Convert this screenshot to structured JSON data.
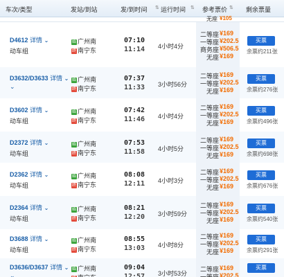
{
  "columns": {
    "train": "车次/类型",
    "stations": "发站/到站",
    "times": "发/到时间",
    "duration": "运行时间",
    "price": "参考票价",
    "remain": "剩余票量"
  },
  "top_strip": {
    "seat": "无座",
    "price": "¥105"
  },
  "rows": [
    {
      "train_no": "D4612",
      "detail": "详情",
      "type": "动车组",
      "from": "广州南",
      "to": "南宁东",
      "dep": "07:10",
      "arr": "11:14",
      "duration": "4小时4分",
      "seats": [
        {
          "n": "二等座",
          "p": "¥169"
        },
        {
          "n": "一等座",
          "p": "¥202.5"
        },
        {
          "n": "商务座",
          "p": "¥506.5"
        },
        {
          "n": "无座",
          "p": "¥169"
        }
      ],
      "buy": "买票",
      "remain": "余票约211张"
    },
    {
      "train_no": "D3632/D3633",
      "detail": "详情",
      "type": "",
      "from": "广州南",
      "to": "南宁东",
      "dep": "07:37",
      "arr": "11:33",
      "duration": "3小时56分",
      "seats": [
        {
          "n": "二等座",
          "p": "¥169"
        },
        {
          "n": "一等座",
          "p": "¥202.5"
        },
        {
          "n": "无座",
          "p": "¥169"
        }
      ],
      "buy": "买票",
      "remain": "余票约276张"
    },
    {
      "train_no": "D3602",
      "detail": "详情",
      "type": "动车组",
      "from": "广州南",
      "to": "南宁东",
      "dep": "07:42",
      "arr": "11:46",
      "duration": "4小时4分",
      "seats": [
        {
          "n": "二等座",
          "p": "¥169"
        },
        {
          "n": "一等座",
          "p": "¥202.5"
        },
        {
          "n": "无座",
          "p": "¥169"
        }
      ],
      "buy": "买票",
      "remain": "余票约496张"
    },
    {
      "train_no": "D2372",
      "detail": "详情",
      "type": "动车组",
      "from": "广州南",
      "to": "南宁东",
      "dep": "07:53",
      "arr": "11:58",
      "duration": "4小时5分",
      "seats": [
        {
          "n": "二等座",
          "p": "¥169"
        },
        {
          "n": "一等座",
          "p": "¥202.5"
        },
        {
          "n": "无座",
          "p": "¥169"
        }
      ],
      "buy": "买票",
      "remain": "余票约698张"
    },
    {
      "train_no": "D2362",
      "detail": "详情",
      "type": "动车组",
      "from": "广州南",
      "to": "南宁东",
      "dep": "08:08",
      "arr": "12:11",
      "duration": "4小时3分",
      "seats": [
        {
          "n": "二等座",
          "p": "¥169"
        },
        {
          "n": "一等座",
          "p": "¥202.5"
        },
        {
          "n": "无座",
          "p": "¥169"
        }
      ],
      "buy": "买票",
      "remain": "余票约676张"
    },
    {
      "train_no": "D2364",
      "detail": "详情",
      "type": "动车组",
      "from": "广州南",
      "to": "南宁东",
      "dep": "08:21",
      "arr": "12:20",
      "duration": "3小时59分",
      "seats": [
        {
          "n": "二等座",
          "p": "¥169"
        },
        {
          "n": "一等座",
          "p": "¥202.5"
        },
        {
          "n": "无座",
          "p": "¥169"
        }
      ],
      "buy": "买票",
      "remain": "余票约540张"
    },
    {
      "train_no": "D3688",
      "detail": "详情",
      "type": "动车组",
      "from": "广州南",
      "to": "南宁东",
      "dep": "08:55",
      "arr": "13:03",
      "duration": "4小时8分",
      "seats": [
        {
          "n": "二等座",
          "p": "¥169"
        },
        {
          "n": "一等座",
          "p": "¥202.5"
        },
        {
          "n": "无座",
          "p": "¥169"
        }
      ],
      "buy": "买票",
      "remain": "余票约291张"
    },
    {
      "train_no": "D3636/D3637",
      "detail": "详情",
      "type": "",
      "from": "广州南",
      "to": "南宁东",
      "dep": "09:04",
      "arr": "12:57",
      "duration": "3小时53分",
      "seats": [
        {
          "n": "二等座",
          "p": "¥169"
        },
        {
          "n": "一等座",
          "p": "¥202.5"
        }
      ],
      "buy": "买票",
      "remain": ""
    }
  ],
  "badges": {
    "start": "始",
    "end": "终"
  },
  "icons": {
    "sort": "sort-arrows-icon",
    "chevron": "chevron-down-icon"
  },
  "colors": {
    "price": "#f26c00",
    "buy": "#1e6cd6",
    "link": "#1a5fa8"
  }
}
